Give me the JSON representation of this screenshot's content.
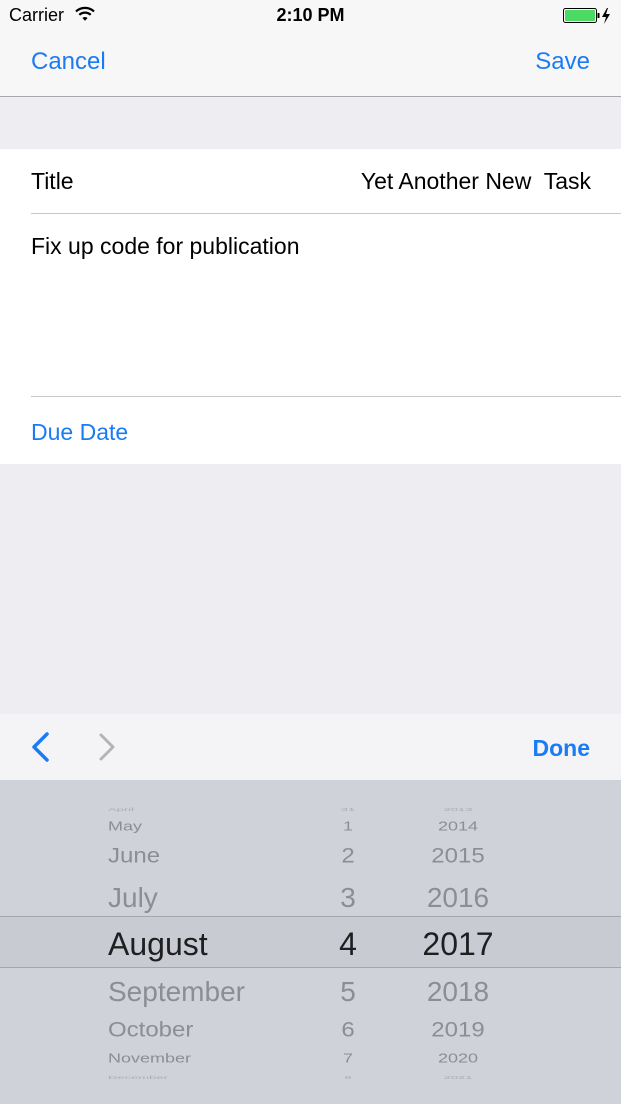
{
  "status_bar": {
    "carrier": "Carrier",
    "time": "2:10 PM"
  },
  "nav": {
    "cancel": "Cancel",
    "save": "Save"
  },
  "form": {
    "title_label": "Title",
    "title_value": "Yet Another New  Task",
    "notes": "Fix up code for publication",
    "due_date_label": "Due Date"
  },
  "toolbar": {
    "prev_icon": "chevron-left-icon",
    "next_icon": "chevron-right-icon",
    "done": "Done"
  },
  "picker": {
    "selected": {
      "month": "August",
      "day": "4",
      "year": "2017"
    },
    "months": [
      "April",
      "May",
      "June",
      "July",
      "August",
      "September",
      "October",
      "November",
      "December"
    ],
    "days": [
      "31",
      "1",
      "2",
      "3",
      "4",
      "5",
      "6",
      "7",
      "8"
    ],
    "years": [
      "2013",
      "2014",
      "2015",
      "2016",
      "2017",
      "2018",
      "2019",
      "2020",
      "2021"
    ]
  },
  "colors": {
    "accent": "#1A7CF5",
    "battery": "#4CD964"
  }
}
